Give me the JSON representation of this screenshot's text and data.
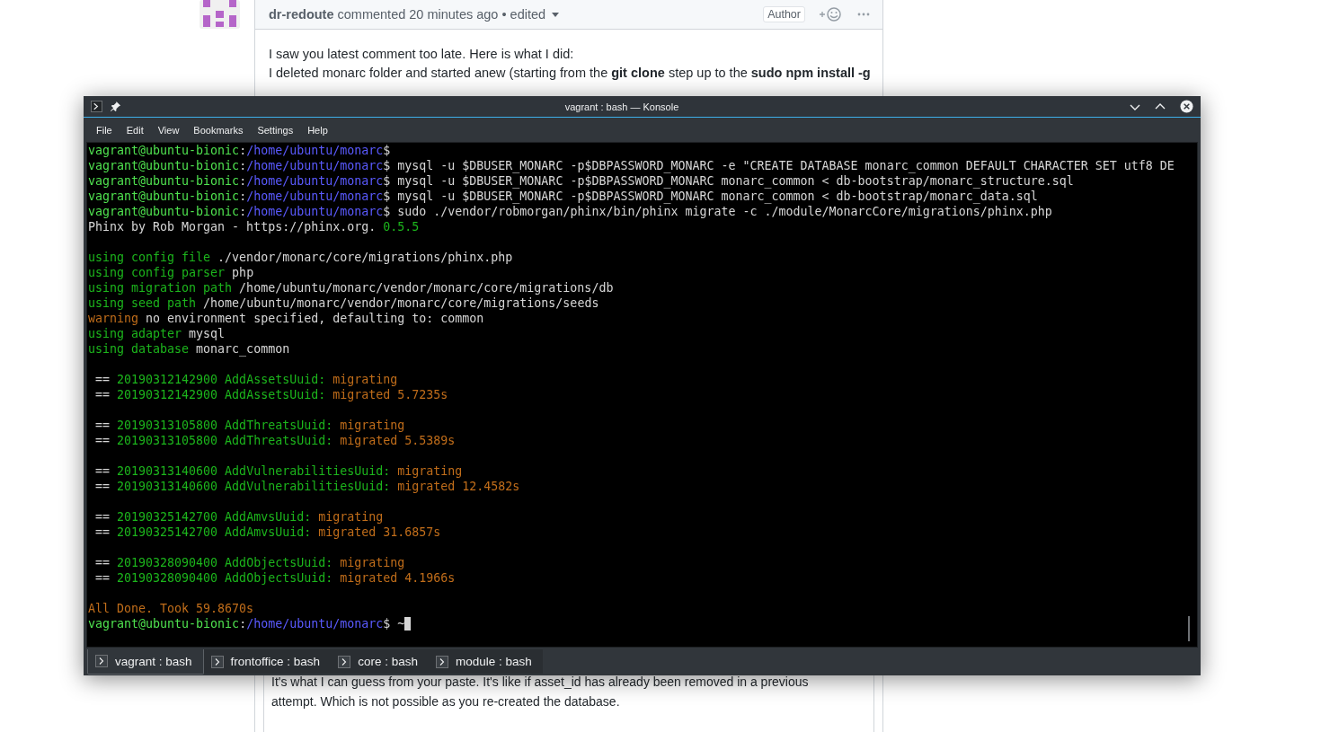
{
  "comment": {
    "author": "dr-redoute",
    "meta": "commented 20 minutes ago • edited",
    "badge": "Author",
    "lines": [
      "I saw you latest comment too late. Here is what I did:",
      "I deleted monarc folder and started anew (starting from the **git clone** step up to the **sudo npm install -g**"
    ],
    "reply": "It's what I can guess from your paste. It's like if asset_id has already been removed in a previous attempt. Which is not possible as you re-created the database."
  },
  "konsole": {
    "title": "vagrant : bash — Konsole",
    "menu": [
      "File",
      "Edit",
      "View",
      "Bookmarks",
      "Settings",
      "Help"
    ],
    "lines": [
      {
        "kind": "text",
        "segments": [
          {
            "kind": "user",
            "text": "vagrant@ubuntu-bionic"
          },
          {
            "kind": "plain",
            "text": ":"
          },
          {
            "kind": "path",
            "text": "/home/ubuntu/monarc"
          },
          {
            "kind": "plain",
            "text": "$"
          }
        ]
      },
      {
        "kind": "text",
        "segments": [
          {
            "kind": "user",
            "text": "vagrant@ubuntu-bionic"
          },
          {
            "kind": "plain",
            "text": ":"
          },
          {
            "kind": "path",
            "text": "/home/ubuntu/monarc"
          },
          {
            "kind": "plain",
            "text": "$ mysql -u $DBUSER_MONARC -p$DBPASSWORD_MONARC -e \"CREATE DATABASE monarc_common DEFAULT CHARACTER SET utf8 DE"
          }
        ]
      },
      {
        "kind": "text",
        "segments": [
          {
            "kind": "user",
            "text": "vagrant@ubuntu-bionic"
          },
          {
            "kind": "plain",
            "text": ":"
          },
          {
            "kind": "path",
            "text": "/home/ubuntu/monarc"
          },
          {
            "kind": "plain",
            "text": "$ mysql -u $DBUSER_MONARC -p$DBPASSWORD_MONARC monarc_common < db-bootstrap/monarc_structure.sql"
          }
        ]
      },
      {
        "kind": "text",
        "segments": [
          {
            "kind": "user",
            "text": "vagrant@ubuntu-bionic"
          },
          {
            "kind": "plain",
            "text": ":"
          },
          {
            "kind": "path",
            "text": "/home/ubuntu/monarc"
          },
          {
            "kind": "plain",
            "text": "$ mysql -u $DBUSER_MONARC -p$DBPASSWORD_MONARC monarc_common < db-bootstrap/monarc_data.sql"
          }
        ]
      },
      {
        "kind": "text",
        "segments": [
          {
            "kind": "user",
            "text": "vagrant@ubuntu-bionic"
          },
          {
            "kind": "plain",
            "text": ":"
          },
          {
            "kind": "path",
            "text": "/home/ubuntu/monarc"
          },
          {
            "kind": "plain",
            "text": "$ sudo ./vendor/robmorgan/phinx/bin/phinx migrate -c ./module/MonarcCore/migrations/phinx.php"
          }
        ]
      },
      {
        "kind": "text",
        "segments": [
          {
            "kind": "plain",
            "text": "Phinx by Rob Morgan - https://phinx.org."
          },
          {
            "kind": "ok",
            "text": " 0.5.5"
          }
        ]
      },
      {
        "kind": "blank"
      },
      {
        "kind": "text",
        "segments": [
          {
            "kind": "ok",
            "text": "using config file"
          },
          {
            "kind": "plain",
            "text": " ./vendor/monarc/core/migrations/phinx.php"
          }
        ]
      },
      {
        "kind": "text",
        "segments": [
          {
            "kind": "ok",
            "text": "using config parser"
          },
          {
            "kind": "plain",
            "text": " php"
          }
        ]
      },
      {
        "kind": "text",
        "segments": [
          {
            "kind": "ok",
            "text": "using migration path"
          },
          {
            "kind": "plain",
            "text": " /home/ubuntu/monarc/vendor/monarc/core/migrations/db"
          }
        ]
      },
      {
        "kind": "text",
        "segments": [
          {
            "kind": "ok",
            "text": "using seed path"
          },
          {
            "kind": "plain",
            "text": " /home/ubuntu/monarc/vendor/monarc/core/migrations/seeds"
          }
        ]
      },
      {
        "kind": "text",
        "segments": [
          {
            "kind": "warn",
            "text": "warning"
          },
          {
            "kind": "plain",
            "text": " no environment specified, defaulting to: common"
          }
        ]
      },
      {
        "kind": "text",
        "segments": [
          {
            "kind": "ok",
            "text": "using adapter"
          },
          {
            "kind": "plain",
            "text": " mysql"
          }
        ]
      },
      {
        "kind": "text",
        "segments": [
          {
            "kind": "ok",
            "text": "using database"
          },
          {
            "kind": "plain",
            "text": " monarc_common"
          }
        ]
      },
      {
        "kind": "blank"
      },
      {
        "kind": "text",
        "segments": [
          {
            "kind": "plain",
            "text": " == "
          },
          {
            "kind": "ok",
            "text": "20190312142900 AddAssetsUuid:"
          },
          {
            "kind": "warn",
            "text": " migrating"
          }
        ]
      },
      {
        "kind": "text",
        "segments": [
          {
            "kind": "plain",
            "text": " == "
          },
          {
            "kind": "ok",
            "text": "20190312142900 AddAssetsUuid:"
          },
          {
            "kind": "warn",
            "text": " migrated 5.7235s"
          }
        ]
      },
      {
        "kind": "blank"
      },
      {
        "kind": "text",
        "segments": [
          {
            "kind": "plain",
            "text": " == "
          },
          {
            "kind": "ok",
            "text": "20190313105800 AddThreatsUuid:"
          },
          {
            "kind": "warn",
            "text": " migrating"
          }
        ]
      },
      {
        "kind": "text",
        "segments": [
          {
            "kind": "plain",
            "text": " == "
          },
          {
            "kind": "ok",
            "text": "20190313105800 AddThreatsUuid:"
          },
          {
            "kind": "warn",
            "text": " migrated 5.5389s"
          }
        ]
      },
      {
        "kind": "blank"
      },
      {
        "kind": "text",
        "segments": [
          {
            "kind": "plain",
            "text": " == "
          },
          {
            "kind": "ok",
            "text": "20190313140600 AddVulnerabilitiesUuid:"
          },
          {
            "kind": "warn",
            "text": " migrating"
          }
        ]
      },
      {
        "kind": "text",
        "segments": [
          {
            "kind": "plain",
            "text": " == "
          },
          {
            "kind": "ok",
            "text": "20190313140600 AddVulnerabilitiesUuid:"
          },
          {
            "kind": "warn",
            "text": " migrated 12.4582s"
          }
        ]
      },
      {
        "kind": "blank"
      },
      {
        "kind": "text",
        "segments": [
          {
            "kind": "plain",
            "text": " == "
          },
          {
            "kind": "ok",
            "text": "20190325142700 AddAmvsUuid:"
          },
          {
            "kind": "warn",
            "text": " migrating"
          }
        ]
      },
      {
        "kind": "text",
        "segments": [
          {
            "kind": "plain",
            "text": " == "
          },
          {
            "kind": "ok",
            "text": "20190325142700 AddAmvsUuid:"
          },
          {
            "kind": "warn",
            "text": " migrated 31.6857s"
          }
        ]
      },
      {
        "kind": "blank"
      },
      {
        "kind": "text",
        "segments": [
          {
            "kind": "plain",
            "text": " == "
          },
          {
            "kind": "ok",
            "text": "20190328090400 AddObjectsUuid:"
          },
          {
            "kind": "warn",
            "text": " migrating"
          }
        ]
      },
      {
        "kind": "text",
        "segments": [
          {
            "kind": "plain",
            "text": " == "
          },
          {
            "kind": "ok",
            "text": "20190328090400 AddObjectsUuid:"
          },
          {
            "kind": "warn",
            "text": " migrated 4.1966s"
          }
        ]
      },
      {
        "kind": "blank"
      },
      {
        "kind": "text",
        "segments": [
          {
            "kind": "warn",
            "text": "All Done. Took 59.8670s"
          }
        ]
      },
      {
        "kind": "text",
        "cursor": true,
        "segments": [
          {
            "kind": "user",
            "text": "vagrant@ubuntu-bionic"
          },
          {
            "kind": "plain",
            "text": ":"
          },
          {
            "kind": "path",
            "text": "/home/ubuntu/monarc"
          },
          {
            "kind": "plain",
            "text": "$ ~"
          }
        ]
      }
    ],
    "tabs": [
      {
        "label": "vagrant : bash",
        "selected": true
      },
      {
        "label": "frontoffice : bash",
        "selected": false
      },
      {
        "label": "core : bash",
        "selected": false
      },
      {
        "label": "module : bash",
        "selected": false
      }
    ]
  }
}
